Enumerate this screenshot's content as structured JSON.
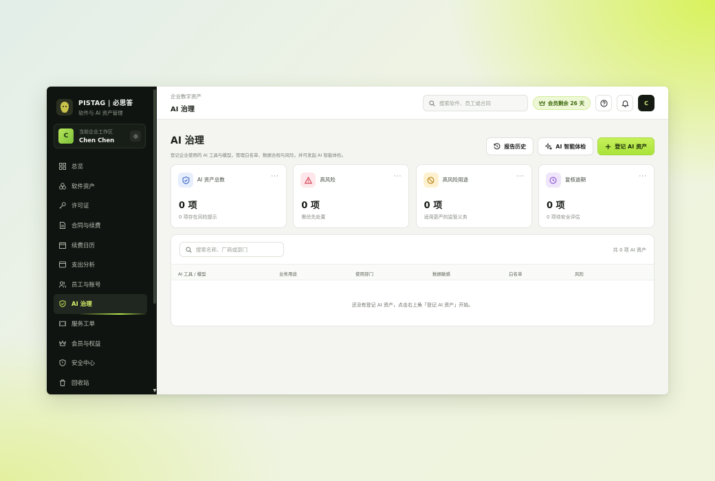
{
  "brand": {
    "title": "PISTAG | 必思答",
    "subtitle": "软件与 AI 资产管理"
  },
  "workspace": {
    "avatar": "C",
    "label": "当前企业工作区",
    "name": "Chen Chen"
  },
  "sidebar": {
    "items": [
      {
        "label": "总览",
        "icon": "grid-icon"
      },
      {
        "label": "软件资产",
        "icon": "cubes-icon"
      },
      {
        "label": "许可证",
        "icon": "key-icon"
      },
      {
        "label": "合同与续费",
        "icon": "document-icon"
      },
      {
        "label": "续费日历",
        "icon": "calendar-icon"
      },
      {
        "label": "支出分析",
        "icon": "wallet-icon"
      },
      {
        "label": "员工与账号",
        "icon": "users-icon"
      },
      {
        "label": "AI 治理",
        "icon": "shield-check-icon",
        "active": true
      },
      {
        "label": "服务工单",
        "icon": "ticket-icon"
      },
      {
        "label": "会员与权益",
        "icon": "crown-icon"
      },
      {
        "label": "安全中心",
        "icon": "shield-icon"
      },
      {
        "label": "回收站",
        "icon": "trash-icon"
      }
    ]
  },
  "header": {
    "crumb": "企业数字资产",
    "title": "AI 治理",
    "search_placeholder": "搜索软件、员工或合同",
    "vip_label": "会员剩余 26 天",
    "user_initial": "C"
  },
  "page": {
    "title": "AI 治理",
    "description": "登记企业使用的 AI 工具与模型，管理白名单、数据合规与风险，并可发起 AI 智能体检。",
    "actions": {
      "history": "报告历史",
      "check": "AI 智能体检",
      "register": "登记 AI 资产"
    }
  },
  "cards": [
    {
      "label": "AI 资产总数",
      "value": "0 项",
      "sub": "0 项存在风险提示",
      "icon": "shield-check-icon"
    },
    {
      "label": "高风险",
      "value": "0 项",
      "sub": "需优先处置",
      "icon": "warning-icon"
    },
    {
      "label": "高风险用途",
      "value": "0 项",
      "sub": "适用更严的监管义务",
      "icon": "ban-icon"
    },
    {
      "label": "复核逾期",
      "value": "0 项",
      "sub": "0 项待安全评估",
      "icon": "clock-icon"
    }
  ],
  "table": {
    "search_placeholder": "搜索名称、厂商或部门",
    "count": "共 0 项 AI 资产",
    "columns": [
      "AI 工具 / 模型",
      "业务用途",
      "使用部门",
      "数据敏感",
      "白名单",
      "风险"
    ],
    "empty": "还没有登记 AI 资产，点击右上角「登记 AI 资产」开始。"
  },
  "colors": {
    "accent": "#b9eb4f",
    "sidebar_bg": "#0f1410"
  }
}
